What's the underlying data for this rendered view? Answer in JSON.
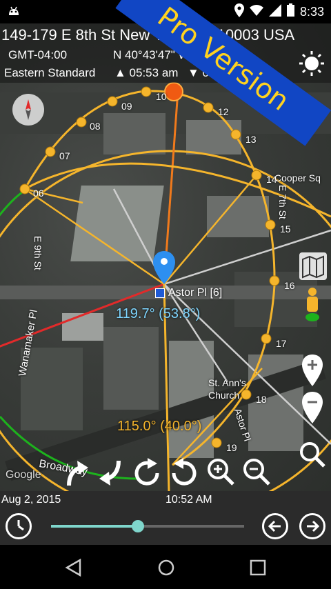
{
  "status_bar": {
    "time": "8:33"
  },
  "header": {
    "address": "149-179 E 8th St New York, NY 10003 USA",
    "timezone_offset": "GMT-04:00",
    "coordinates": "N 40°43'47\" W 73",
    "timezone_name": "Eastern Standard",
    "sunrise": "▲ 05:53 am",
    "sunset": "▼ 08:10"
  },
  "ribbon_text": "Pro Version",
  "map": {
    "hour_labels": [
      "06",
      "07",
      "08",
      "09",
      "10",
      "12",
      "13",
      "14",
      "15",
      "16",
      "17",
      "18",
      "19"
    ],
    "place_labels": {
      "astor_pl": "Astor Pl [6]",
      "e9th": "E 9th St",
      "e7th": "E 7th St",
      "wanamaker": "Wanamaker Pl",
      "st_anns": "St. Ann's Church",
      "astor_pl_road": "Astor Pl",
      "cooper_sq": "Cooper Sq",
      "broadway": "Broadway",
      "google": "Google"
    },
    "sun_angle": "119.7° (53.8°)",
    "shadow_angle": "115.0° (40.0°)"
  },
  "bottom_bar": {
    "date": "Aug 2, 2015",
    "time": "10:52 AM",
    "slider_value": 0.45
  },
  "colors": {
    "sun_path": "#f5b52c",
    "sunrise_line": "#e22a2a",
    "sunset_line": "#1db31d",
    "accent_slider": "#7fd6cc"
  }
}
